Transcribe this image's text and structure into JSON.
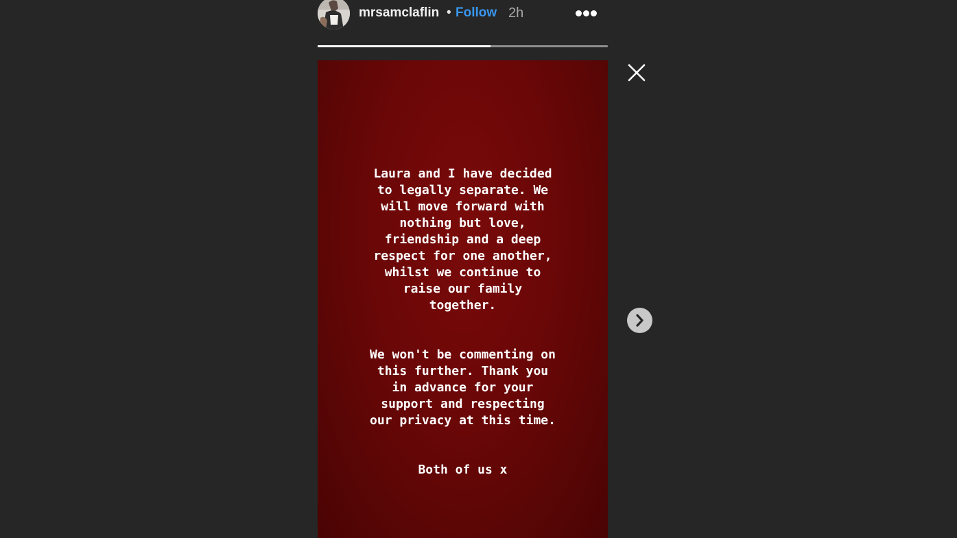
{
  "header": {
    "username": "mrsamclaflin",
    "separator": "•",
    "follow_label": "Follow",
    "time_ago": "2h",
    "more_icon": "more-horizontal-icon"
  },
  "progress": {
    "fraction": 0.595
  },
  "story": {
    "background_color": "#6a0707",
    "paragraph_1": "Laura and I have decided\nto legally separate. We\nwill move forward with\nnothing but love,\nfriendship and a deep\nrespect for one another,\nwhilst we continue to\nraise our family\ntogether.",
    "paragraph_2": "We won't be commenting on\nthis further. Thank you\nin advance for your\nsupport and respecting\nour privacy at this time.",
    "paragraph_3": "Both of us x"
  },
  "controls": {
    "close_icon": "close-icon",
    "next_icon": "chevron-right-icon"
  },
  "colors": {
    "background": "#262626",
    "accent": "#3897f0"
  }
}
